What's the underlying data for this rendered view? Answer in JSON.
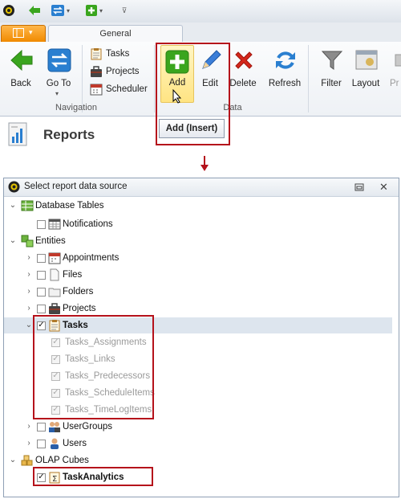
{
  "ribbon": {
    "tab_general": "General",
    "buttons": {
      "back": "Back",
      "goto": "Go To",
      "add": "Add",
      "edit": "Edit",
      "delete": "Delete",
      "refresh": "Refresh",
      "filter": "Filter",
      "layout": "Layout",
      "print_partial": "Pr"
    },
    "small_buttons": {
      "tasks": "Tasks",
      "projects": "Projects",
      "scheduler": "Scheduler"
    },
    "groups": {
      "navigation": "Navigation",
      "data": "Data"
    },
    "tooltip": "Add (Insert)"
  },
  "page": {
    "title": "Reports"
  },
  "dialog": {
    "title": "Select report data source",
    "tree": {
      "database_tables": "Database Tables",
      "notifications": "Notifications",
      "entities": "Entities",
      "appointments": "Appointments",
      "files": "Files",
      "folders": "Folders",
      "projects": "Projects",
      "tasks": "Tasks",
      "tasks_assignments": "Tasks_Assignments",
      "tasks_links": "Tasks_Links",
      "tasks_predecessors": "Tasks_Predecessors",
      "tasks_scheduleitems": "Tasks_ScheduleItems",
      "tasks_timelogitems": "Tasks_TimeLogItems",
      "usergroups": "UserGroups",
      "users": "Users",
      "olap_cubes": "OLAP Cubes",
      "taskanalytics": "TaskAnalytics"
    }
  },
  "colors": {
    "highlight_red": "#b5121b",
    "add_green": "#3aa51e",
    "delete_red": "#d4271c",
    "refresh_blue": "#2a7fd0"
  }
}
